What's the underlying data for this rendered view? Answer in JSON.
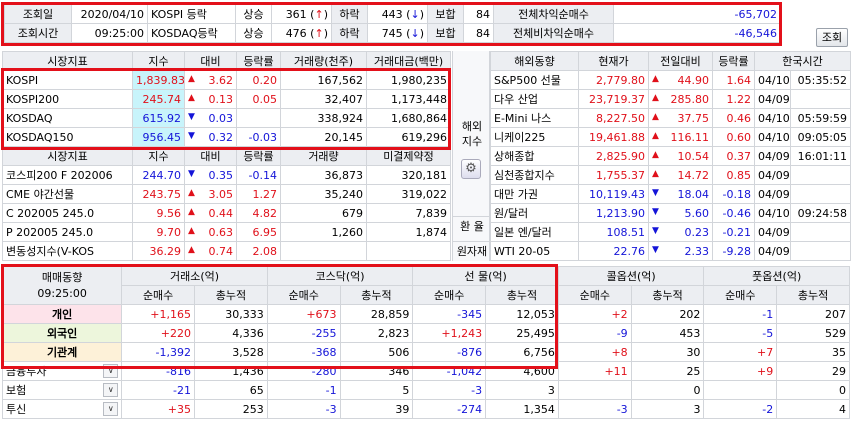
{
  "top": {
    "date_label": "조회일",
    "date_value": "2020/04/10",
    "time_label": "조회시간",
    "time_value": "09:25:00",
    "rows": [
      {
        "market": "KOSPI 등락",
        "up_label": "상승",
        "up": "361",
        "up_arrow": "↑",
        "down_label": "하락",
        "down": "443",
        "down_arrow": "↓",
        "flat_label": "보합",
        "flat": "84",
        "net_label": "전체차익순매수",
        "net": "-65,702"
      },
      {
        "market": "KOSDAQ등락",
        "up_label": "상승",
        "up": "476",
        "up_arrow": "↑",
        "down_label": "하락",
        "down": "745",
        "down_arrow": "↓",
        "flat_label": "보합",
        "flat": "84",
        "net_label": "전체비차익순매수",
        "net": "-46,546"
      }
    ],
    "query_button": "조회"
  },
  "market": {
    "headers": [
      "시장지표",
      "지수",
      "대비",
      "등락률",
      "거래량(천주)",
      "거래대금(백만)"
    ],
    "rows": [
      {
        "name": "KOSPI",
        "index": "1,839.83",
        "dir": "up",
        "change": "3.62",
        "rate": "0.20",
        "volume": "167,562",
        "amount": "1,980,235"
      },
      {
        "name": "KOSPI200",
        "index": "245.74",
        "dir": "up",
        "change": "0.13",
        "rate": "0.05",
        "volume": "32,407",
        "amount": "1,173,448"
      },
      {
        "name": "KOSDAQ",
        "index": "615.92",
        "dir": "down",
        "change": "0.03",
        "rate": "",
        "volume": "338,924",
        "amount": "1,680,864"
      },
      {
        "name": "KOSDAQ150",
        "index": "956.45",
        "dir": "down",
        "change": "0.32",
        "rate": "-0.03",
        "volume": "20,145",
        "amount": "619,296"
      }
    ],
    "headers2": [
      "시장지표",
      "지수",
      "대비",
      "등락률",
      "거래량",
      "미결제약정"
    ],
    "rows2": [
      {
        "name": "코스피200 F 202006",
        "index": "244.70",
        "dir": "down",
        "change": "0.35",
        "rate": "-0.14",
        "volume": "36,873",
        "amount": "320,181"
      },
      {
        "name": "CME 야간선물",
        "index": "243.75",
        "dir": "up",
        "change": "3.05",
        "rate": "1.27",
        "volume": "35,240",
        "amount": "319,022"
      },
      {
        "name": "C 202005 245.0",
        "index": "9.56",
        "dir": "up",
        "change": "0.44",
        "rate": "4.82",
        "volume": "679",
        "amount": "7,839"
      },
      {
        "name": "P 202005 245.0",
        "index": "9.70",
        "dir": "up",
        "change": "0.63",
        "rate": "6.95",
        "volume": "1,260",
        "amount": "1,874"
      },
      {
        "name": "변동성지수(V-KOS",
        "index": "36.29",
        "dir": "up",
        "change": "0.74",
        "rate": "2.08",
        "volume": "",
        "amount": ""
      }
    ]
  },
  "side": {
    "overseas": "해외지수",
    "fx": "환 율",
    "fx_material": "원자재"
  },
  "overseas": {
    "headers": [
      "해외동향",
      "현재가",
      "전일대비",
      "등락률",
      "한국시간"
    ],
    "rows": [
      {
        "name": "S&P500 선물",
        "price": "2,779.80",
        "dir": "up",
        "change": "44.90",
        "rate": "1.64",
        "date": "04/10",
        "time": "05:35:52"
      },
      {
        "name": "다우 산업",
        "price": "23,719.37",
        "dir": "up",
        "change": "285.80",
        "rate": "1.22",
        "date": "04/09",
        "time": ""
      },
      {
        "name": "E-Mini 나스",
        "price": "8,227.50",
        "dir": "up",
        "change": "37.75",
        "rate": "0.46",
        "date": "04/10",
        "time": "05:59:59"
      },
      {
        "name": "니케이225",
        "price": "19,461.88",
        "dir": "up",
        "change": "116.11",
        "rate": "0.60",
        "date": "04/10",
        "time": "09:05:05"
      },
      {
        "name": "상해종합",
        "price": "2,825.90",
        "dir": "up",
        "change": "10.54",
        "rate": "0.37",
        "date": "04/09",
        "time": "16:01:11"
      },
      {
        "name": "심천종합지수",
        "price": "1,755.37",
        "dir": "up",
        "change": "14.72",
        "rate": "0.85",
        "date": "04/09",
        "time": ""
      },
      {
        "name": "대만 가권",
        "price": "10,119.43",
        "dir": "down",
        "change": "18.04",
        "rate": "-0.18",
        "date": "04/09",
        "time": ""
      },
      {
        "name": "원/달러",
        "price": "1,213.90",
        "dir": "down",
        "change": "5.60",
        "rate": "-0.46",
        "date": "04/10",
        "time": "09:24:58"
      },
      {
        "name": "일본 엔/달러",
        "price": "108.51",
        "dir": "down",
        "change": "0.23",
        "rate": "-0.21",
        "date": "04/09",
        "time": ""
      },
      {
        "name": "WTI 20-05",
        "price": "22.76",
        "dir": "down",
        "change": "2.33",
        "rate": "-9.28",
        "date": "04/09",
        "time": ""
      }
    ]
  },
  "trend": {
    "title": "매매동향",
    "time": "09:25:00",
    "groups": [
      "거래소(억)",
      "코스닥(억)",
      "선 물(억)",
      "콜옵션(억)",
      "풋옵션(억)"
    ],
    "sub": [
      "순매수",
      "총누적"
    ],
    "rows": [
      {
        "name": "개인",
        "v": [
          "+1,165",
          "30,333",
          "+673",
          "28,859",
          "-345",
          "12,053",
          "+2",
          "202",
          "-1",
          "207"
        ]
      },
      {
        "name": "외국인",
        "v": [
          "+220",
          "4,336",
          "-255",
          "2,823",
          "+1,243",
          "25,495",
          "-9",
          "453",
          "-5",
          "529"
        ]
      },
      {
        "name": "기관계",
        "v": [
          "-1,392",
          "3,528",
          "-368",
          "506",
          "-876",
          "6,756",
          "+8",
          "30",
          "+7",
          "35"
        ]
      },
      {
        "name": "금융투자",
        "v": [
          "-816",
          "1,436",
          "-280",
          "346",
          "-1,042",
          "4,600",
          "+11",
          "25",
          "+9",
          "29"
        ]
      },
      {
        "name": "보험",
        "v": [
          "-21",
          "65",
          "-1",
          "5",
          "-3",
          "3",
          "",
          "0",
          "",
          "0"
        ]
      },
      {
        "name": "투신",
        "v": [
          "+35",
          "253",
          "-3",
          "39",
          "-274",
          "1,354",
          "-3",
          "3",
          "-2",
          "4"
        ]
      }
    ]
  },
  "colors": {
    "up": "#e0101a",
    "down": "#1414d8",
    "highlight": "#e3101a",
    "cyan": "#c8f4fb"
  }
}
